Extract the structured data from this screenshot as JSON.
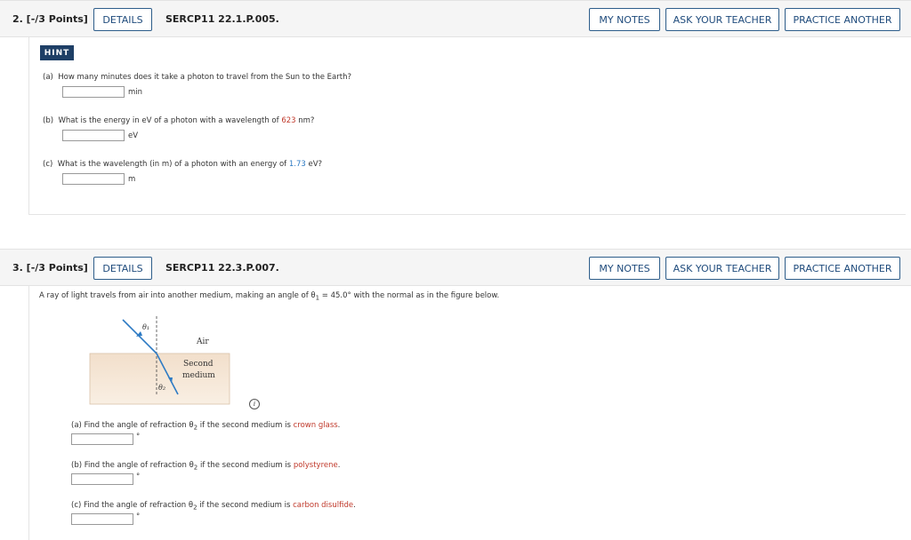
{
  "q2": {
    "number": "2.  [-/3 Points]",
    "details": "DETAILS",
    "code": "SERCP11 22.1.P.005.",
    "my_notes": "MY NOTES",
    "ask_teacher": "ASK YOUR TEACHER",
    "practice": "PRACTICE ANOTHER",
    "hint": "HINT",
    "parts": [
      {
        "label": "(a)",
        "text": "How many minutes does it take a photon to travel from the Sun to the Earth?",
        "unit": "min",
        "value": ""
      },
      {
        "label": "(b)",
        "text_before": "What is the energy in eV of a photon with a wavelength of ",
        "highlight": "623",
        "text_after": " nm?",
        "unit": "eV",
        "value": ""
      },
      {
        "label": "(c)",
        "text_before": "What is the wavelength (in m) of a photon with an energy of ",
        "highlight": "1.73",
        "text_after": " eV?",
        "unit": "m",
        "value": ""
      }
    ]
  },
  "q3": {
    "number": "3.  [-/3 Points]",
    "details": "DETAILS",
    "code": "SERCP11 22.3.P.007.",
    "my_notes": "MY NOTES",
    "ask_teacher": "ASK YOUR TEACHER",
    "practice": "PRACTICE ANOTHER",
    "intro_before": "A ray of light travels from air into another medium, making an angle of θ",
    "intro_sub": "1",
    "intro_after": " = 45.0° with the normal as in the figure below.",
    "figure": {
      "theta1": "θ₁",
      "air": "Air",
      "second_1": "Second",
      "second_2": "medium",
      "theta2": "θ₂"
    },
    "info_icon": "info-icon",
    "parts": [
      {
        "label": "(a)",
        "text_before": "Find the angle of refraction θ",
        "sub": "2",
        "text_mid": " if the second medium is ",
        "material": "crown glass",
        "text_after": ".",
        "unit": "°",
        "value": ""
      },
      {
        "label": "(b)",
        "text_before": "Find the angle of refraction θ",
        "sub": "2",
        "text_mid": " if the second medium is ",
        "material": "polystyrene",
        "text_after": ".",
        "unit": "°",
        "value": ""
      },
      {
        "label": "(c)",
        "text_before": "Find the angle of refraction θ",
        "sub": "2",
        "text_mid": " if the second medium is ",
        "material": "carbon disulfide",
        "text_after": ".",
        "unit": "°",
        "value": ""
      }
    ]
  },
  "colors": {
    "accent": "#1f4b7c",
    "hint_bg": "#1e3f66",
    "highlight_red": "#c0392b",
    "highlight_blue": "#2e7bc4"
  }
}
